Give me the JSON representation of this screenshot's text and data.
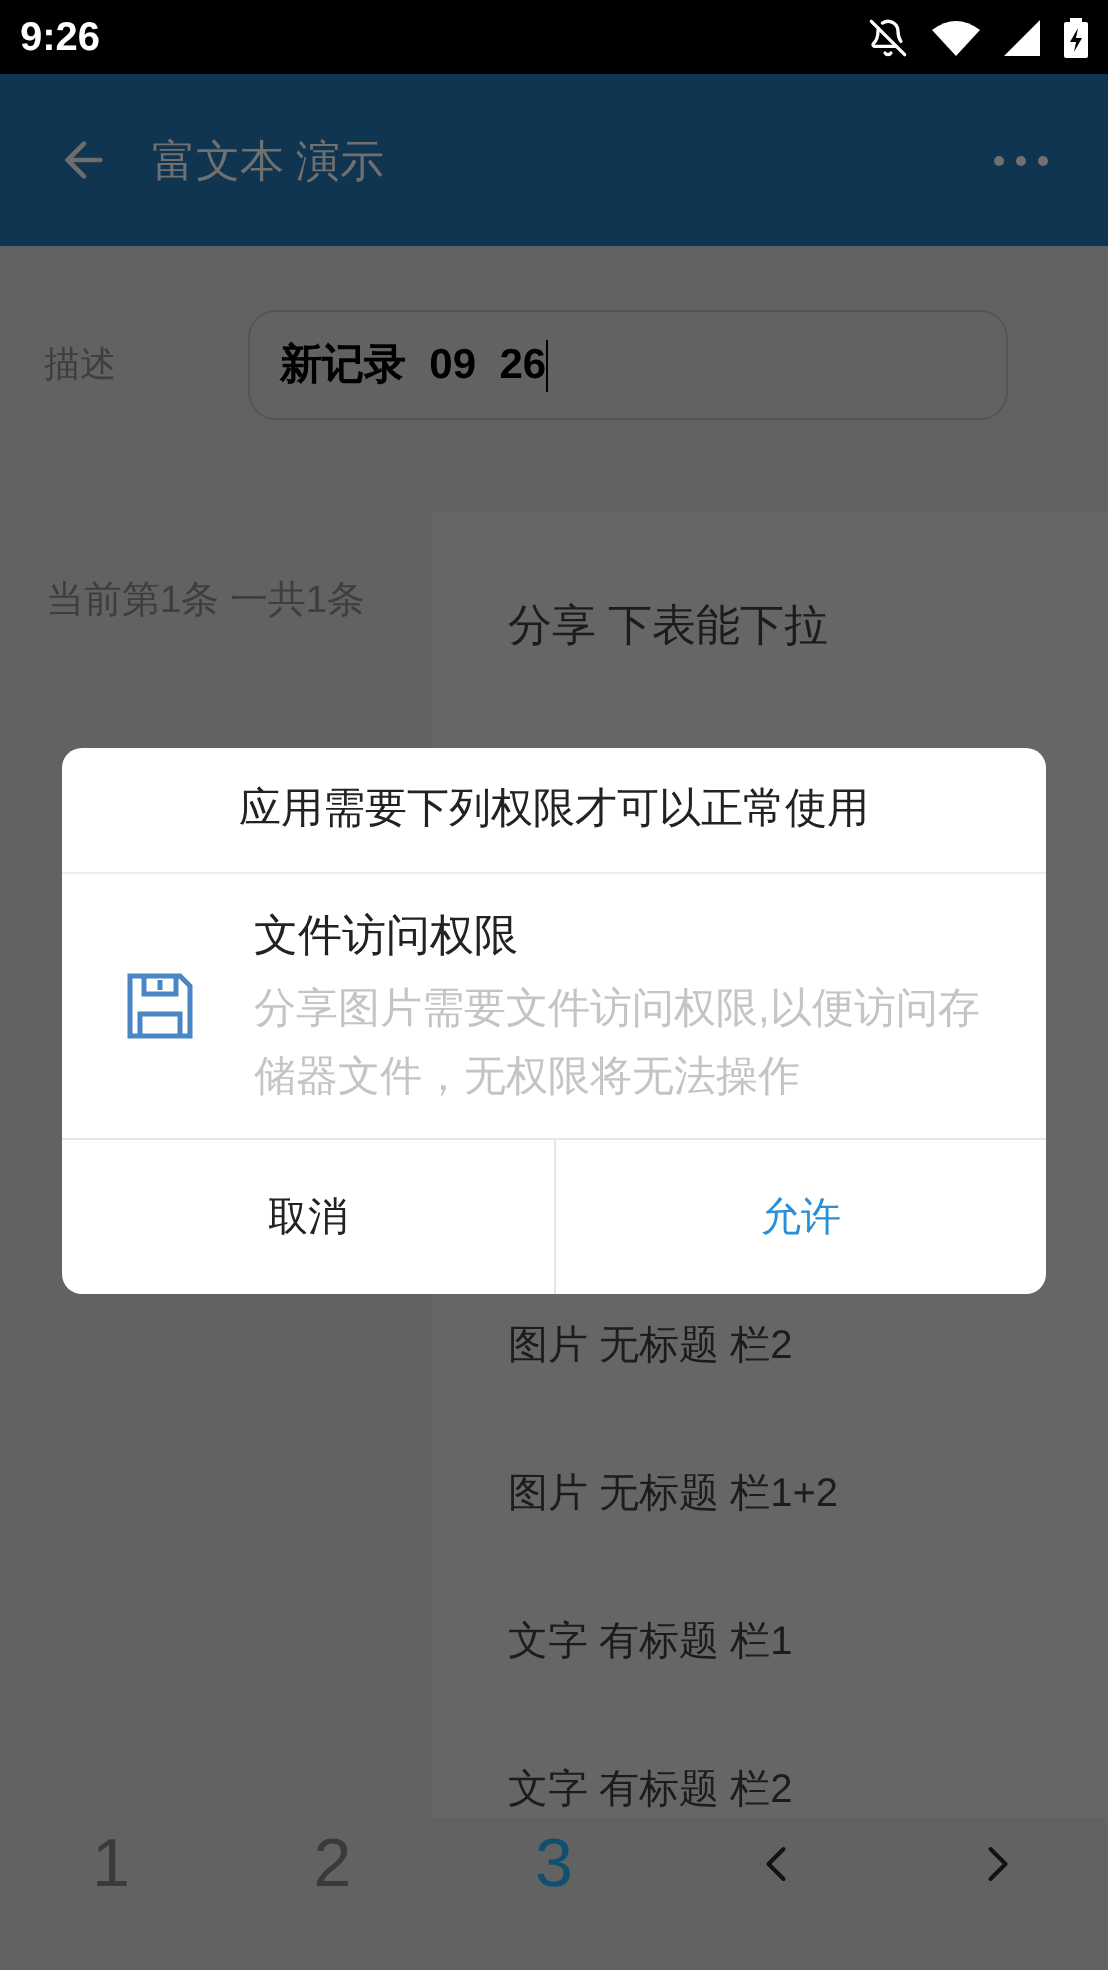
{
  "status_bar": {
    "time": "9:26"
  },
  "app_bar": {
    "title": "富文本 演示"
  },
  "form": {
    "label": "描述",
    "value": "新记录  09  26"
  },
  "record_info": "当前第1条 一共1条",
  "dropdown": {
    "top_items": [
      "分享 下表能下拉"
    ],
    "bottom_items": [
      "图片 无标题 栏2",
      "图片 无标题 栏1+2",
      "文字 有标题 栏1",
      "文字 有标题 栏2"
    ]
  },
  "pagination": [
    {
      "kind": "page",
      "label": "1",
      "selected": false
    },
    {
      "kind": "page",
      "label": "2",
      "selected": false
    },
    {
      "kind": "page",
      "label": "3",
      "selected": true
    },
    {
      "kind": "prev"
    },
    {
      "kind": "next"
    }
  ],
  "dialog": {
    "title": "应用需要下列权限才可以正常使用",
    "permission": {
      "name": "文件访问权限",
      "description": "分享图片需要文件访问权限,以便访问存储器文件，无权限将无法操作"
    },
    "buttons": [
      {
        "label": "取消",
        "kind": "cancel"
      },
      {
        "label": "允许",
        "kind": "confirm"
      }
    ]
  }
}
